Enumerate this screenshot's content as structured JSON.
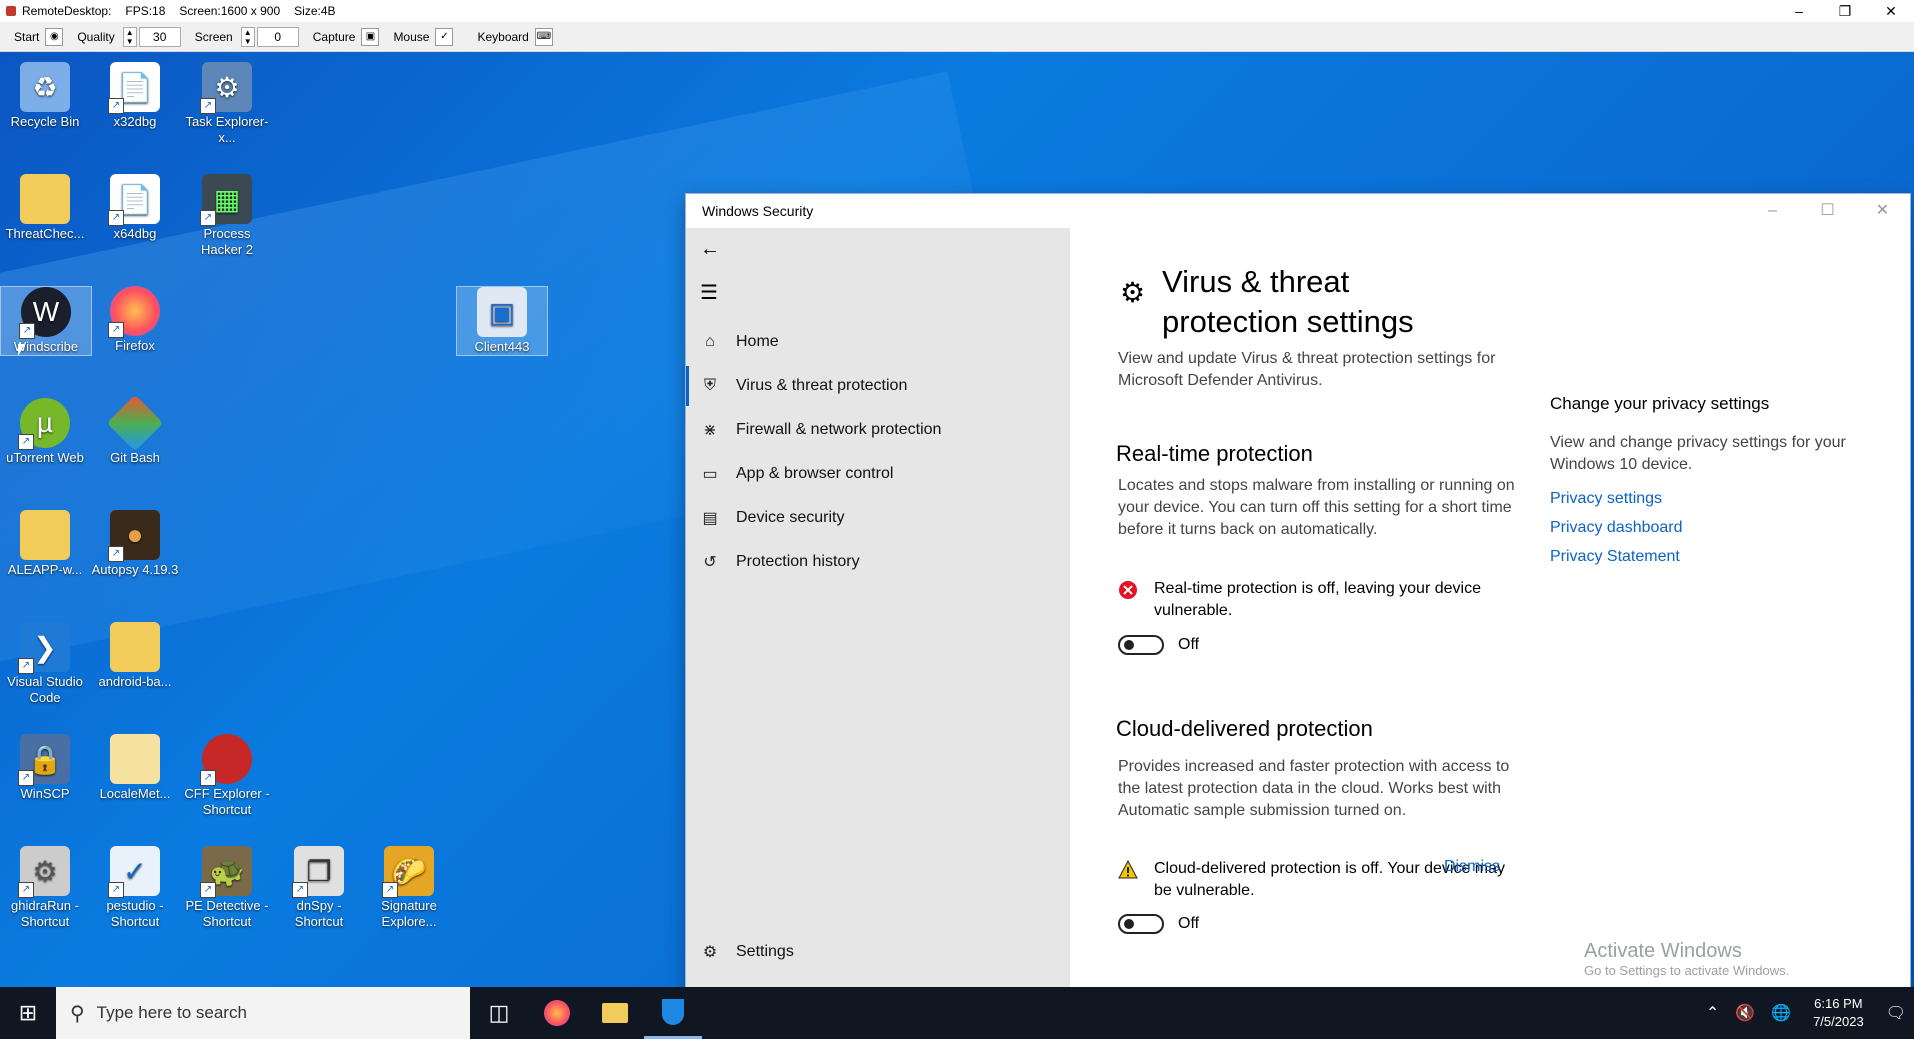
{
  "rd": {
    "title": "RemoteDesktop:",
    "fps": "FPS:18",
    "screen": "Screen:1600 x 900",
    "size": "Size:4B",
    "toolbar": {
      "start": "Start",
      "quality": "Quality",
      "quality_value": "30",
      "screen": "Screen",
      "screen_value": "0",
      "capture": "Capture",
      "mouse": "Mouse",
      "keyboard": "Keyboard"
    }
  },
  "desktop": {
    "icons": [
      {
        "label": "Recycle Bin",
        "icon": "recycle-bin-icon"
      },
      {
        "label": "x32dbg",
        "icon": "file-icon"
      },
      {
        "label": "Task Explorer-x...",
        "icon": "task-explorer-icon"
      },
      {
        "label": "ThreatChec...",
        "icon": "folder-icon"
      },
      {
        "label": "x64dbg",
        "icon": "file-icon"
      },
      {
        "label": "Process Hacker 2",
        "icon": "process-hacker-icon"
      },
      {
        "label": "Windscribe",
        "icon": "windscribe-icon"
      },
      {
        "label": "Firefox",
        "icon": "firefox-icon"
      },
      {
        "label": "Client443",
        "icon": "client-icon"
      },
      {
        "label": "uTorrent Web",
        "icon": "utorrent-icon"
      },
      {
        "label": "Git Bash",
        "icon": "git-bash-icon"
      },
      {
        "label": "ALEAPP-w...",
        "icon": "folder-icon"
      },
      {
        "label": "Autopsy 4.19.3",
        "icon": "autopsy-icon"
      },
      {
        "label": "Visual Studio Code",
        "icon": "vscode-icon"
      },
      {
        "label": "android-ba...",
        "icon": "folder-icon"
      },
      {
        "label": "WinSCP",
        "icon": "winscp-icon"
      },
      {
        "label": "LocaleMet...",
        "icon": "folder-icon"
      },
      {
        "label": "CFF Explorer - Shortcut",
        "icon": "cff-explorer-icon"
      },
      {
        "label": "ghidraRun - Shortcut",
        "icon": "ghidra-icon"
      },
      {
        "label": "pestudio - Shortcut",
        "icon": "pestudio-icon"
      },
      {
        "label": "PE Detective - Shortcut",
        "icon": "pe-detective-icon"
      },
      {
        "label": "dnSpy - Shortcut",
        "icon": "dnspy-icon"
      },
      {
        "label": "Signature Explore...",
        "icon": "signature-explorer-icon"
      }
    ]
  },
  "window": {
    "title": "Windows Security",
    "nav": {
      "items": [
        {
          "label": "Home",
          "icon": "home-icon"
        },
        {
          "label": "Virus & threat protection",
          "icon": "shield-icon",
          "active": true
        },
        {
          "label": "Firewall & network protection",
          "icon": "antenna-icon"
        },
        {
          "label": "App & browser control",
          "icon": "browser-window-icon"
        },
        {
          "label": "Device security",
          "icon": "laptop-icon"
        },
        {
          "label": "Protection history",
          "icon": "history-icon"
        }
      ],
      "settings": "Settings"
    },
    "content": {
      "title": "Virus & threat protection settings",
      "description": "View and update Virus & threat protection settings for Microsoft Defender Antivirus.",
      "realtime": {
        "heading": "Real-time protection",
        "body": "Locates and stops malware from installing or running on your device. You can turn off this setting for a short time before it turns back on automatically.",
        "status": "Real-time protection is off, leaving your device vulnerable.",
        "toggle_label": "Off"
      },
      "cloud": {
        "heading": "Cloud-delivered protection",
        "body": "Provides increased and faster protection with access to the latest protection data in the cloud. Works best with Automatic sample submission turned on.",
        "status": "Cloud-delivered protection is off. Your device may be vulnerable.",
        "dismiss": "Dismiss",
        "toggle_label": "Off"
      },
      "privacy": {
        "heading": "Change your privacy settings",
        "body": "View and change privacy settings for your Windows 10 device.",
        "links": [
          "Privacy settings",
          "Privacy dashboard",
          "Privacy Statement"
        ]
      },
      "watermark": {
        "line1": "Activate Windows",
        "line2": "Go to Settings to activate Windows."
      }
    }
  },
  "taskbar": {
    "search_placeholder": "Type here to search",
    "time": "6:16 PM",
    "date": "7/5/2023"
  },
  "colors": {
    "accent": "#0b63c6",
    "error": "#e81123",
    "warning": "#f2c500",
    "desktop": "#0b6fd6",
    "taskbar": "#101722"
  }
}
